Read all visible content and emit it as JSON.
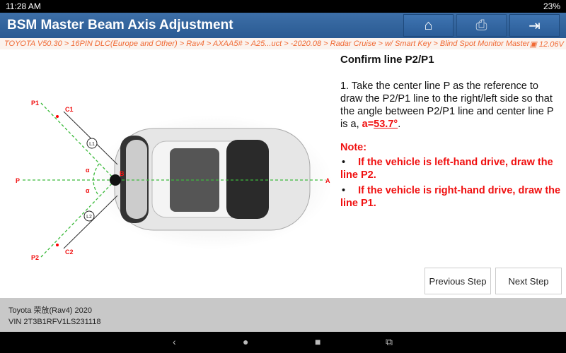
{
  "status_bar": {
    "time": "11:28 AM",
    "battery": "23%"
  },
  "header": {
    "title": "BSM Master Beam Axis Adjustment",
    "buttons": [
      "home-icon",
      "print-icon",
      "exit-icon"
    ]
  },
  "breadcrumb": {
    "path": "TOYOTA V50.30 > 16PIN DLC(Europe and Other) > Rav4 > AXAA5# > A25...uct > -2020.08 > Radar Cruise > w/ Smart Key > Blind Spot Monitor Master",
    "voltage": "12.06V"
  },
  "diagram": {
    "labels": {
      "p1": "P1",
      "p2": "P2",
      "p": "P",
      "a": "A",
      "c1": "C1",
      "c2": "C2",
      "l1": "L1",
      "l2": "L2",
      "b": "B",
      "alpha": "α"
    }
  },
  "instructions": {
    "heading": "Confirm line P2/P1",
    "step_text": "1. Take the center line P as the reference to draw the P2/P1 line to the right/left side so that the angle between P2/P1 line and center line P is a, ",
    "angle_prefix": "a=",
    "angle_value": "53.7°",
    "note_title": "Note:",
    "notes": [
      "If the vehicle is left-hand drive, draw the line P2.",
      "If the vehicle is right-hand drive, draw the line P1."
    ]
  },
  "buttons": {
    "previous": "Previous Step",
    "next": "Next Step"
  },
  "footer": {
    "vehicle": "Toyota 荣放(Rav4) 2020",
    "vin": "VIN 2T3B1RFV1LS231118"
  },
  "colors": {
    "header": "#2f5f95",
    "breadcrumb_text": "#f06a35",
    "accent_red": "#f01010"
  }
}
